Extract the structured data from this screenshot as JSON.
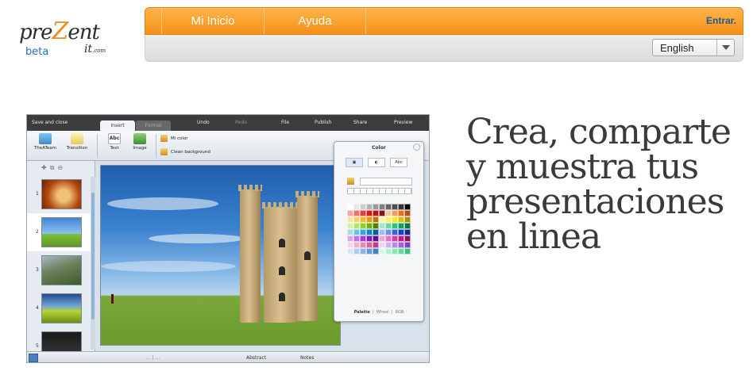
{
  "logo": {
    "brand_pre": "pre",
    "brand_z": "Z",
    "brand_post": "ent",
    "beta": "beta",
    "it": "it",
    "it_suffix": ".com",
    "accent_color": "#f08a10"
  },
  "nav": {
    "items": [
      {
        "label": "Mi Inicio"
      },
      {
        "label": "Ayuda"
      }
    ],
    "login": "Entrar.",
    "bar_color": "#f5901a"
  },
  "language": {
    "selected": "English"
  },
  "app": {
    "topbar": {
      "save": "Save and close",
      "undo": "Undo",
      "redo": "Redo",
      "file": "File",
      "publish": "Publish",
      "share": "Share",
      "preview": "Preview"
    },
    "tabs": [
      {
        "label": "Insert"
      },
      {
        "label": "Format"
      }
    ],
    "ribbon": {
      "theme": "TheATeam",
      "transition": "Transition",
      "text": "Text",
      "text_icon": "Abc",
      "image": "Image",
      "mi_color": "Mi color",
      "clean_background": "Clean background"
    },
    "slides": [
      {
        "num": "1"
      },
      {
        "num": "2"
      },
      {
        "num": "3"
      },
      {
        "num": "4"
      },
      {
        "num": "5"
      }
    ],
    "color_panel": {
      "title": "Color",
      "tab_text": "Abc",
      "footer": {
        "palette": "Palette",
        "wheel": "Wheel",
        "rgb": "RGB"
      },
      "palette": [
        "#ffffff",
        "#e6e6e6",
        "#cccccc",
        "#b3b3b3",
        "#999999",
        "#808080",
        "#666666",
        "#4d4d4d",
        "#333333",
        "#000000",
        "#f4a6a6",
        "#f07070",
        "#e83a3a",
        "#d91a1a",
        "#b81414",
        "#8f0f0f",
        "#f8c6a0",
        "#f39a5c",
        "#e8701f",
        "#b04f0f",
        "#fce4a6",
        "#f9cf6b",
        "#f5b930",
        "#e39b0f",
        "#b3780a",
        "#fff6a6",
        "#fff06b",
        "#ffe62e",
        "#d9c20f",
        "#a6930a",
        "#d6f0a6",
        "#b5e36b",
        "#8fd12e",
        "#6fb00f",
        "#4f800a",
        "#a6e6c6",
        "#6bd6a0",
        "#2ec279",
        "#0fa05c",
        "#0a7542",
        "#a6d9f0",
        "#6bc2e8",
        "#2ea6dc",
        "#0f86c0",
        "#0a5f8a",
        "#a6b9f0",
        "#7090e8",
        "#3a60dc",
        "#1a3fc0",
        "#102a8a",
        "#d9a6f0",
        "#c070e8",
        "#a03adc",
        "#801ac0",
        "#5a108a",
        "#f0a6d9",
        "#e870c0",
        "#dc3aa0",
        "#c01a80",
        "#8a105a",
        "#f9d6e6",
        "#f0b0cc",
        "#e88ab3",
        "#dc6499",
        "#c03e7f",
        "#e6d6f9",
        "#ccb0f0",
        "#b38ae8",
        "#9964dc",
        "#7f3ec0",
        "#d6e6f9",
        "#b0ccf0",
        "#8ab3e8",
        "#6499dc",
        "#3e7fc0",
        "#d6f9e6",
        "#b0f0cc",
        "#8ae8b3",
        "#64dc99",
        "#3ec07f"
      ]
    },
    "statusbar": {
      "pager": "... | ...",
      "abstract": "Abstract",
      "notes": "Notes"
    }
  },
  "headline": {
    "line1": "Crea, comparte",
    "line2": "y muestra tus",
    "line3": "presentaciones",
    "line4": "en linea"
  }
}
